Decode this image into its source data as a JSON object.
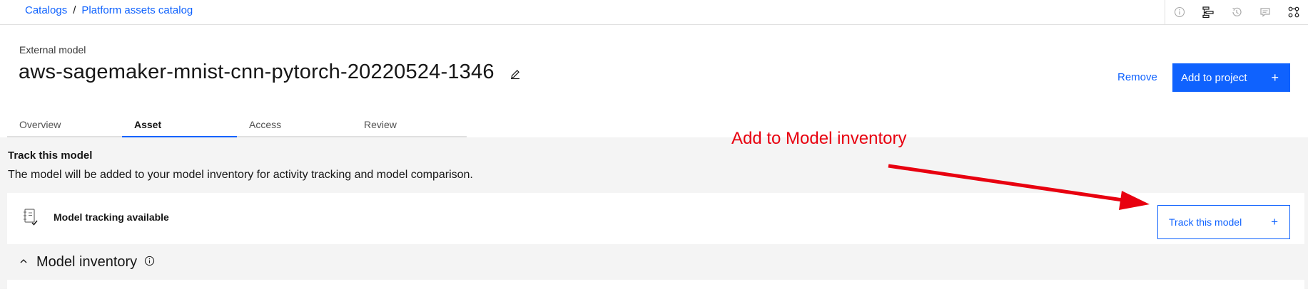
{
  "breadcrumb": {
    "items": [
      "Catalogs",
      "Platform assets catalog"
    ],
    "separator": "/"
  },
  "top_icons": [
    "info-icon",
    "lineage-icon",
    "history-icon",
    "comment-icon",
    "relationships-icon"
  ],
  "header": {
    "asset_type": "External model",
    "title": "aws-sagemaker-mnist-cnn-pytorch-20220524-1346",
    "remove_label": "Remove",
    "add_to_project_label": "Add to project",
    "plus_symbol": "+"
  },
  "tabs": [
    {
      "label": "Overview",
      "active": false
    },
    {
      "label": "Asset",
      "active": true
    },
    {
      "label": "Access",
      "active": false
    },
    {
      "label": "Review",
      "active": false
    }
  ],
  "track_section": {
    "heading": "Track this model",
    "description": "The model will be added to your model inventory for activity tracking and model comparison.",
    "status_label": "Model tracking available",
    "button_label": "Track this model",
    "plus_symbol": "+"
  },
  "inventory": {
    "title": "Model inventory",
    "expanded": true
  },
  "annotation": {
    "text": "Add to Model inventory",
    "color": "#e8000f"
  },
  "colors": {
    "accent": "#0f62fe",
    "content_bg": "#f4f4f4",
    "annotation": "#e8000f"
  }
}
